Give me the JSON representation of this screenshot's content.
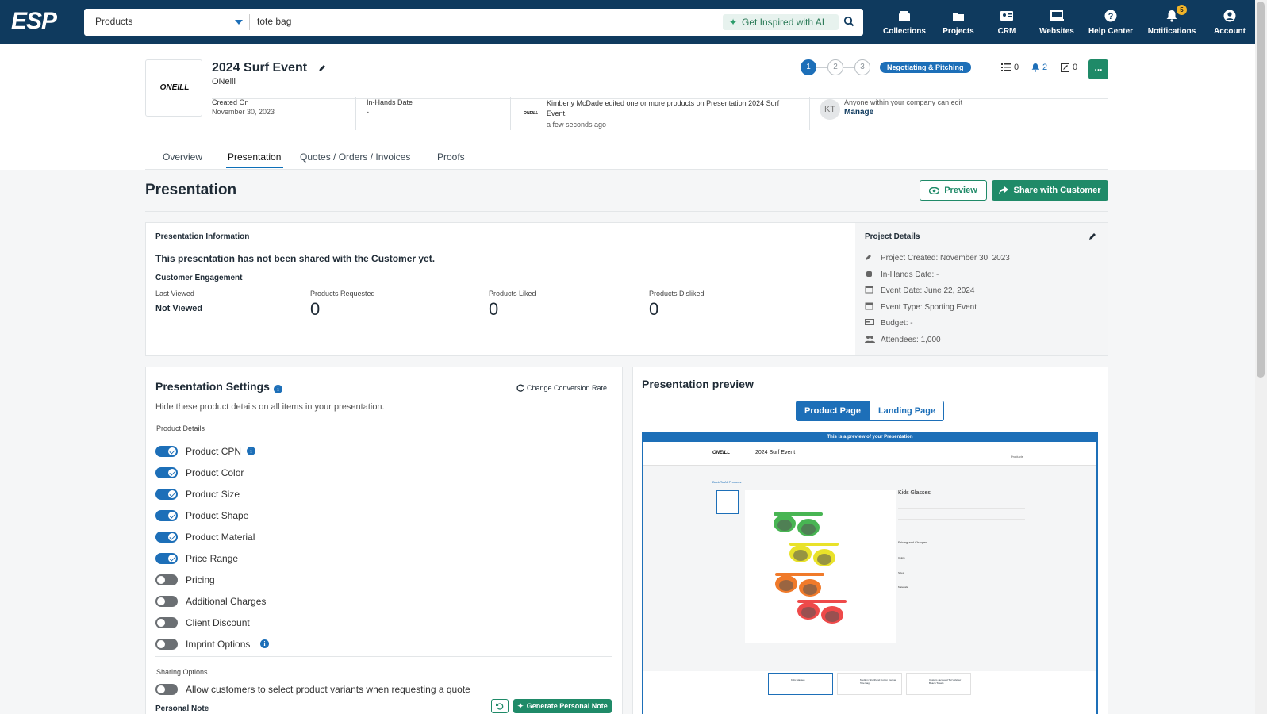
{
  "nav": {
    "logo": "ESP",
    "search_category": "Products",
    "search_value": "tote bag",
    "ai_button": "Get Inspired with AI",
    "items": [
      {
        "label": "Collections",
        "icon": "collections-icon"
      },
      {
        "label": "Projects",
        "icon": "folder-icon"
      },
      {
        "label": "CRM",
        "icon": "contact-card-icon"
      },
      {
        "label": "Websites",
        "icon": "laptop-icon"
      },
      {
        "label": "Help Center",
        "icon": "help-icon"
      },
      {
        "label": "Notifications",
        "icon": "bell-icon",
        "badge": "5"
      },
      {
        "label": "Account",
        "icon": "account-icon"
      }
    ]
  },
  "project": {
    "logo_text": "ONEILL",
    "title": "2024 Surf Event",
    "client": "ONeill",
    "created_label": "Created On",
    "created_value": "November 30, 2023",
    "inhands_label": "In-Hands Date",
    "inhands_value": "-",
    "activity_text": "Kimberly McDade edited one or more products on Presentation 2024 Surf Event.",
    "activity_time": "a few seconds ago",
    "avatar_initials": "KT",
    "access_text": "Anyone within your company can edit",
    "manage_label": "Manage",
    "steps": [
      "1",
      "2",
      "3"
    ],
    "status": "Negotiating & Pitching",
    "counts": {
      "tasks": "0",
      "notifications": "2",
      "notes": "0"
    },
    "more_label": "..."
  },
  "tabs": [
    {
      "label": "Overview",
      "active": false
    },
    {
      "label": "Presentation",
      "active": true
    },
    {
      "label": "Quotes / Orders / Invoices",
      "active": false
    },
    {
      "label": "Proofs",
      "active": false
    }
  ],
  "page": {
    "title": "Presentation",
    "preview_button": "Preview",
    "share_button": "Share with Customer"
  },
  "info_card": {
    "heading": "Presentation Information",
    "notice": "This presentation has not been shared with the Customer yet.",
    "engagement_heading": "Customer Engagement",
    "last_viewed_label": "Last Viewed",
    "last_viewed_value": "Not Viewed",
    "stats": [
      {
        "label": "Products Requested",
        "value": "0"
      },
      {
        "label": "Products Liked",
        "value": "0"
      },
      {
        "label": "Products Disliked",
        "value": "0"
      }
    ]
  },
  "project_details": {
    "heading": "Project Details",
    "rows": [
      {
        "text": "Project Created: November 30, 2023",
        "icon": "pencil-icon"
      },
      {
        "text": "In-Hands Date: -",
        "icon": "hand-icon"
      },
      {
        "text": "Event Date: June 22, 2024",
        "icon": "calendar-icon"
      },
      {
        "text": "Event Type: Sporting Event",
        "icon": "calendar-icon"
      },
      {
        "text": "Budget: -",
        "icon": "money-icon"
      },
      {
        "text": "Attendees: 1,000",
        "icon": "people-icon"
      }
    ]
  },
  "settings": {
    "heading": "Presentation Settings",
    "conversion_link": "Change Conversion Rate",
    "subtitle": "Hide these product details on all items in your presentation.",
    "product_details_label": "Product Details",
    "toggles": [
      {
        "label": "Product CPN",
        "on": true,
        "info": true
      },
      {
        "label": "Product Color",
        "on": true,
        "info": false
      },
      {
        "label": "Product Size",
        "on": true,
        "info": false
      },
      {
        "label": "Product Shape",
        "on": true,
        "info": false
      },
      {
        "label": "Product Material",
        "on": true,
        "info": false
      },
      {
        "label": "Price Range",
        "on": true,
        "info": false
      },
      {
        "label": "Pricing",
        "on": false,
        "info": false
      },
      {
        "label": "Additional Charges",
        "on": false,
        "info": false
      },
      {
        "label": "Client Discount",
        "on": false,
        "info": false
      },
      {
        "label": "Imprint Options",
        "on": false,
        "info": true
      }
    ],
    "sharing_label": "Sharing Options",
    "sharing_toggle": {
      "label": "Allow customers to select product variants when requesting a quote",
      "on": false
    },
    "personal_note_label": "Personal Note",
    "generate_note_button": "Generate Personal Note"
  },
  "preview": {
    "heading": "Presentation preview",
    "tab_product": "Product Page",
    "tab_landing": "Landing Page",
    "banner": "This is a preview of your Presentation",
    "site_title": "2024 Surf Event",
    "site_logo": "ONEILL",
    "products_nav": "Products",
    "back_link": "Back To All Products",
    "product_name": "Kids Glasses",
    "pricing_heading": "Pricing and Charges",
    "sections": [
      "Colors",
      "Sizes",
      "Materials"
    ],
    "thumbs": [
      "Kids Glasses",
      "Medium Shorthand Cotton Canvas Tote Bag",
      "Custom Jacquard Terry Velour Beach Towels"
    ]
  },
  "colors": {
    "nav": "#0f3a5e",
    "primary": "#1d6fb8",
    "green": "#1f8a68"
  }
}
